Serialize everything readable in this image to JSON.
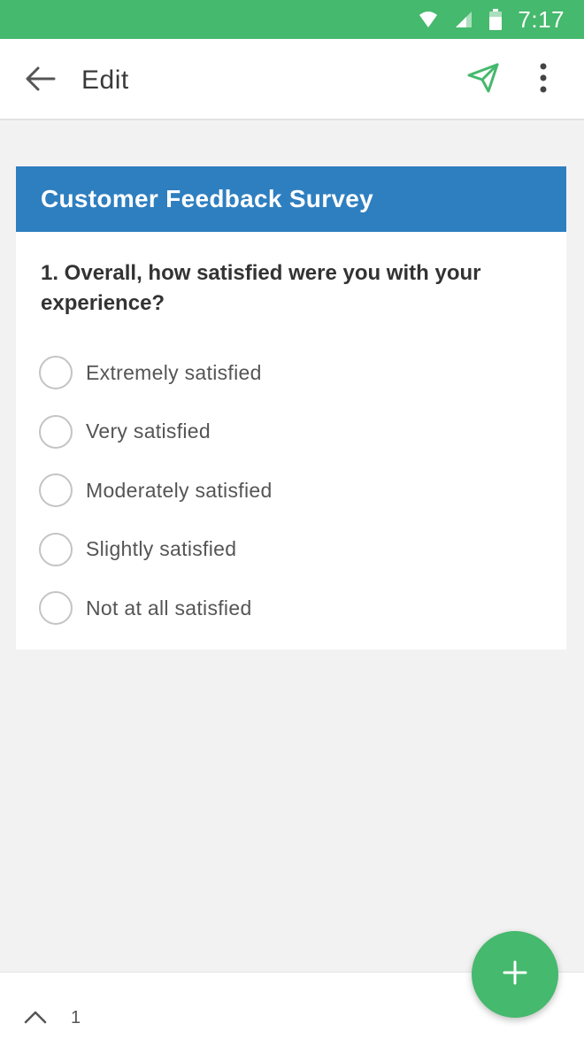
{
  "status_bar": {
    "time": "7:17",
    "icons": [
      "wifi-icon",
      "signal-icon",
      "battery-icon"
    ],
    "background": "#45b96d"
  },
  "app_bar": {
    "title": "Edit",
    "icons": [
      "back-arrow-icon",
      "send-icon",
      "more-vert-icon"
    ],
    "accent": "#45b96d"
  },
  "survey": {
    "title": "Customer Feedback Survey",
    "header_color": "#2e7fc0",
    "question": "1. Overall, how satisfied were you with your experience?",
    "options": [
      "Extremely satisfied",
      "Very satisfied",
      "Moderately satisfied",
      "Slightly satisfied",
      "Not at all satisfied"
    ]
  },
  "bottom_bar": {
    "page_number": "1",
    "icons": [
      "chevron-up-icon"
    ]
  },
  "fab": {
    "icon": "plus-icon",
    "color": "#45b96d"
  }
}
